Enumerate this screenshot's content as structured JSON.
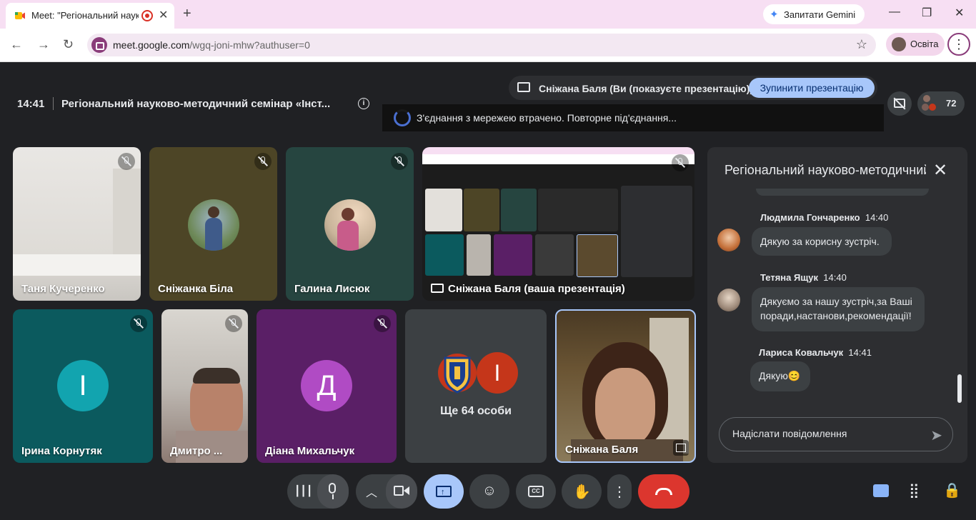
{
  "browser": {
    "tab_title": "Meet: \"Регіональний науко",
    "tab_close": "✕",
    "new_tab": "+",
    "gemini_label": "Запитати Gemini",
    "url_main": "meet.google.com",
    "url_rest": "/wgq-joni-mhw?authuser=0",
    "profile_label": "Освіта",
    "icons": [
      "back-icon",
      "forward-icon",
      "reload-icon",
      "bookmark-star-icon",
      "menu-dots-icon",
      "minimize-icon",
      "maximize-icon",
      "close-icon"
    ]
  },
  "meet": {
    "time": "14:41",
    "title": "Регіональний науково-методичний семінар «Інст...",
    "presenting_text": "Сніжана Баля (Ви (показуєте презентацію))",
    "stop_presenting": "Зупинити презентацію",
    "reconnect_text": "З'єднання з мережею втрачено. Повторне під'єднання...",
    "participant_count": "72"
  },
  "tiles": {
    "t1_name": "Таня Кучеренко",
    "t2_name": "Сніжанка Біла",
    "t3_name": "Галина Лисюк",
    "t4_name": "Сніжана Баля (ваша презентація)",
    "t5_name": "Ірина Корнутяк",
    "t5_letter": "І",
    "t6_name": "Дмитро ...",
    "t7_name": "Діана Михальчук",
    "t7_letter": "Д",
    "t8_more": "Ще 64 особи",
    "t8_letter": "І",
    "t9_name": "Сніжана Баля"
  },
  "chat": {
    "title": "Регіональний науково-методичний семінар",
    "messages": [
      {
        "author": "Людмила Гончаренко",
        "time": "14:40",
        "text": "Дякую за корисну зустріч."
      },
      {
        "author": "Тетяна Ящук",
        "time": "14:40",
        "text": "Дякуємо  за нашу зустріч,за Ваші поради,настанови,рекомендації!"
      },
      {
        "author": "Лариса Ковальчук",
        "time": "14:41",
        "text": "Дякую😊"
      }
    ],
    "input_placeholder": "Надіслати повідомлення"
  },
  "colors": {
    "accent_blue": "#a8c7fa",
    "hangup_red": "#dc362e",
    "teal_avatar": "#12a4af",
    "purple_avatar": "#b04bc4",
    "red_avatar": "#c5361a"
  }
}
